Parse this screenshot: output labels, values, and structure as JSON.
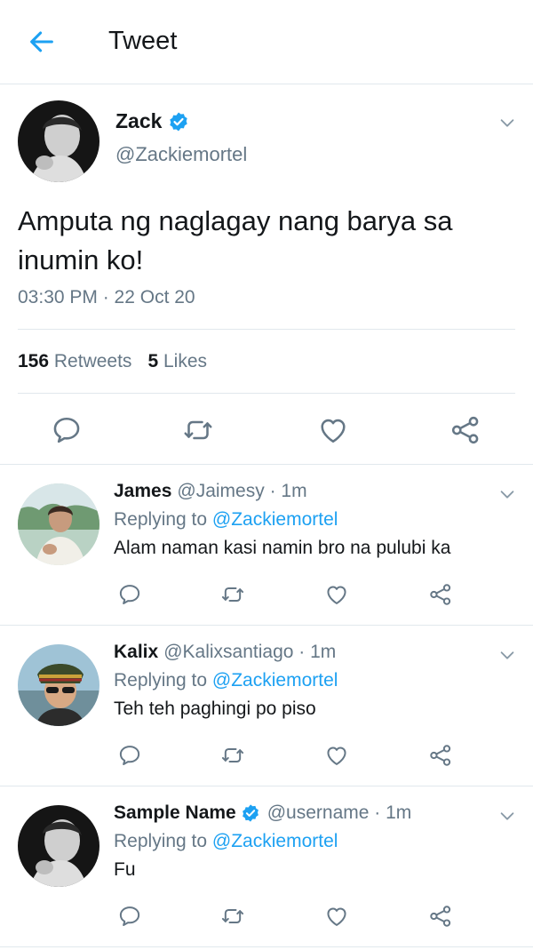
{
  "header": {
    "title": "Tweet"
  },
  "main_tweet": {
    "name": "Zack",
    "verified": true,
    "handle": "@Zackiemortel",
    "text": "Amputa ng naglagay nang barya sa inumin ko!",
    "time": "03:30 PM · 22 Oct 20",
    "retweets_count": "156",
    "retweets_label": "Retweets",
    "likes_count": "5",
    "likes_label": "Likes"
  },
  "replies": [
    {
      "name": "James",
      "verified": false,
      "handle": "@Jaimesy",
      "sep": " · ",
      "time": "1m",
      "replying_prefix": "Replying to ",
      "replying_to": "@Zackiemortel",
      "text": "Alam naman kasi namin bro na pulubi ka"
    },
    {
      "name": "Kalix",
      "verified": false,
      "handle": "@Kalixsantiago",
      "sep": " · ",
      "time": "1m",
      "replying_prefix": "Replying to ",
      "replying_to": "@Zackiemortel",
      "text": "Teh teh paghingi po piso"
    },
    {
      "name": "Sample Name",
      "verified": true,
      "handle": "@username",
      "sep": " · ",
      "time": "1m",
      "replying_prefix": "Replying to ",
      "replying_to": "@Zackiemortel",
      "text": "Fu"
    }
  ],
  "colors": {
    "accent": "#1da1f2",
    "secondary_text": "#657786",
    "primary_text": "#14171a",
    "divider": "#e1e8ed"
  },
  "icons": {
    "back": "arrow-left-icon",
    "verified": "verified-badge-icon",
    "caret": "chevron-down-icon",
    "reply": "reply-bubble-icon",
    "retweet": "retweet-icon",
    "like": "heart-icon",
    "share": "share-icon"
  }
}
